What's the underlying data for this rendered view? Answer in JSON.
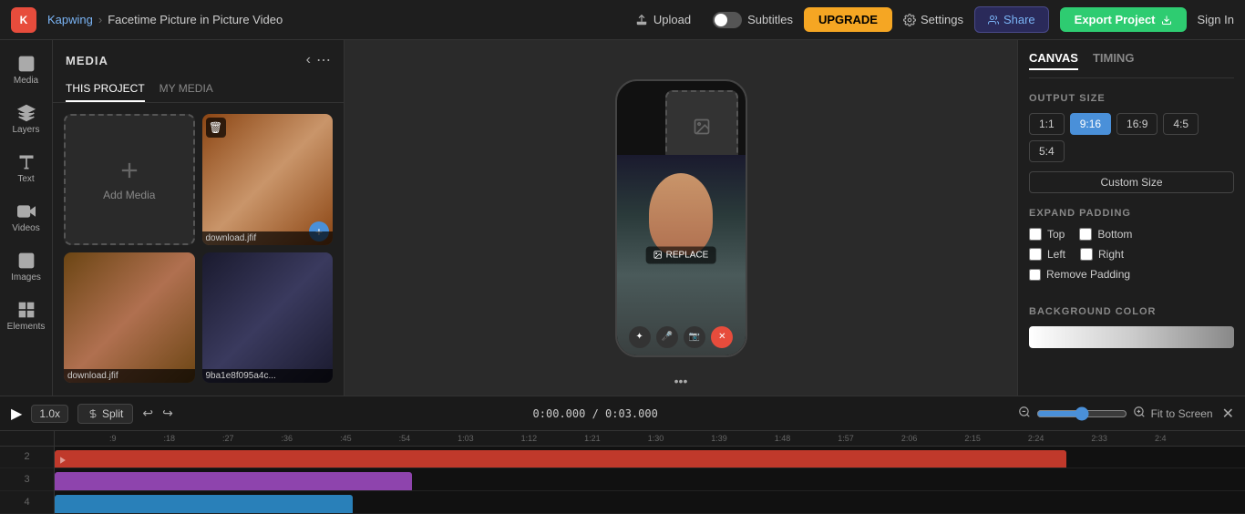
{
  "topbar": {
    "logo_text": "K",
    "brand_name": "Kapwing",
    "project_title": "Facetime Picture in Picture Video",
    "upload_label": "Upload",
    "subtitles_label": "Subtitles",
    "upgrade_label": "UPGRADE",
    "settings_label": "Settings",
    "share_label": "Share",
    "export_label": "Export Project",
    "signin_label": "Sign In"
  },
  "sidebar": {
    "items": [
      {
        "id": "media",
        "label": "Media",
        "icon": "media-icon"
      },
      {
        "id": "layers",
        "label": "Layers",
        "icon": "layers-icon"
      },
      {
        "id": "text",
        "label": "Text",
        "icon": "text-icon"
      },
      {
        "id": "videos",
        "label": "Videos",
        "icon": "videos-icon"
      },
      {
        "id": "images",
        "label": "Images",
        "icon": "images-icon"
      },
      {
        "id": "elements",
        "label": "Elements",
        "icon": "elements-icon"
      }
    ]
  },
  "media_panel": {
    "title": "MEDIA",
    "tab_project": "THIS PROJECT",
    "tab_my_media": "MY MEDIA",
    "add_media_label": "Add Media",
    "items": [
      {
        "id": "item1",
        "name": "download.jfif",
        "type": "image-girl"
      },
      {
        "id": "item2",
        "name": "download.jfif",
        "type": "image-girl2"
      },
      {
        "id": "item3",
        "name": "9ba1e8f095a4c...",
        "type": "image-man"
      }
    ]
  },
  "right_panel": {
    "tab_canvas": "CANVAS",
    "tab_timing": "TIMING",
    "output_size_label": "OUTPUT SIZE",
    "size_options": [
      "1:1",
      "9:16",
      "16:9",
      "4:5",
      "5:4"
    ],
    "active_size": "9:16",
    "custom_size_label": "Custom Size",
    "expand_padding_label": "EXPAND PADDING",
    "padding_top_label": "Top",
    "padding_bottom_label": "Bottom",
    "padding_left_label": "Left",
    "padding_right_label": "Right",
    "remove_padding_label": "Remove Padding",
    "bg_color_label": "BACKGROUND COLOR"
  },
  "canvas": {
    "replace_label": "REPLACE",
    "more_dots": "•••"
  },
  "timeline": {
    "speed_label": "1.0x",
    "split_label": "Split",
    "time_current": "0:00.000",
    "time_total": "0:03.000",
    "fit_screen_label": "Fit to Screen",
    "ruler_marks": [
      ":9",
      ":18",
      ":27",
      ":36",
      ":45",
      ":54",
      "1:03",
      "1:12",
      "1:21",
      "1:30",
      "1:39",
      "1:48",
      "1:57",
      "2:06",
      "2:15",
      "2:24",
      "2:33",
      "2:4"
    ],
    "track_labels": [
      "2",
      "3",
      "4"
    ],
    "zoom_level": 50
  }
}
